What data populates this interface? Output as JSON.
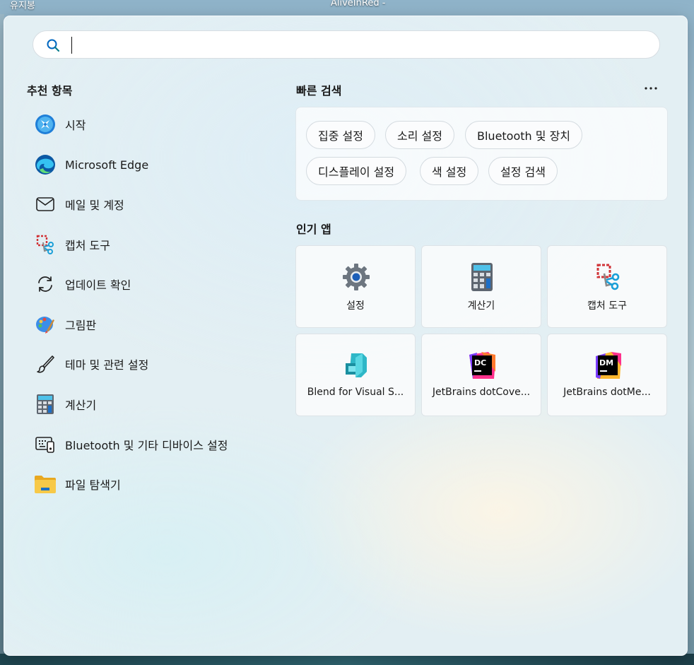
{
  "desktop": {
    "label_left": "유지봉",
    "label_center": "AliveInRed -"
  },
  "search": {
    "placeholder": "",
    "value": ""
  },
  "recommended": {
    "title": "추천 항목",
    "items": [
      {
        "label": "시작",
        "icon": "tips-icon"
      },
      {
        "label": "Microsoft Edge",
        "icon": "edge-icon"
      },
      {
        "label": "메일 및 계정",
        "icon": "mail-icon"
      },
      {
        "label": "캡처 도구",
        "icon": "snipping-tool-icon"
      },
      {
        "label": "업데이트 확인",
        "icon": "refresh-icon"
      },
      {
        "label": "그림판",
        "icon": "paint-icon"
      },
      {
        "label": "테마 및 관련 설정",
        "icon": "brush-icon"
      },
      {
        "label": "계산기",
        "icon": "calculator-icon"
      },
      {
        "label": "Bluetooth 및 기타 디바이스 설정",
        "icon": "devices-icon"
      },
      {
        "label": "파일 탐색기",
        "icon": "folder-icon"
      }
    ]
  },
  "quick_search": {
    "title": "빠른 검색",
    "chips": [
      "집중 설정",
      "소리 설정",
      "Bluetooth 및 장치",
      "디스플레이 설정",
      "색 설정",
      "설정 검색"
    ]
  },
  "top_apps": {
    "title": "인기 앱",
    "apps": [
      {
        "label": "설정",
        "icon": "settings-gear-icon"
      },
      {
        "label": "계산기",
        "icon": "calculator-icon"
      },
      {
        "label": "캡처 도구",
        "icon": "snipping-tool-icon"
      },
      {
        "label": "Blend for Visual S...",
        "icon": "blend-icon"
      },
      {
        "label": "JetBrains dotCove...",
        "icon": "dotcover-icon",
        "badge": "DC"
      },
      {
        "label": "JetBrains dotMe...",
        "icon": "dotmemory-icon",
        "badge": "DM"
      }
    ]
  },
  "colors": {
    "accent": "#0067c0",
    "jetbrains_dc": "#ff318c",
    "jetbrains_dm": "#fcb72e"
  }
}
